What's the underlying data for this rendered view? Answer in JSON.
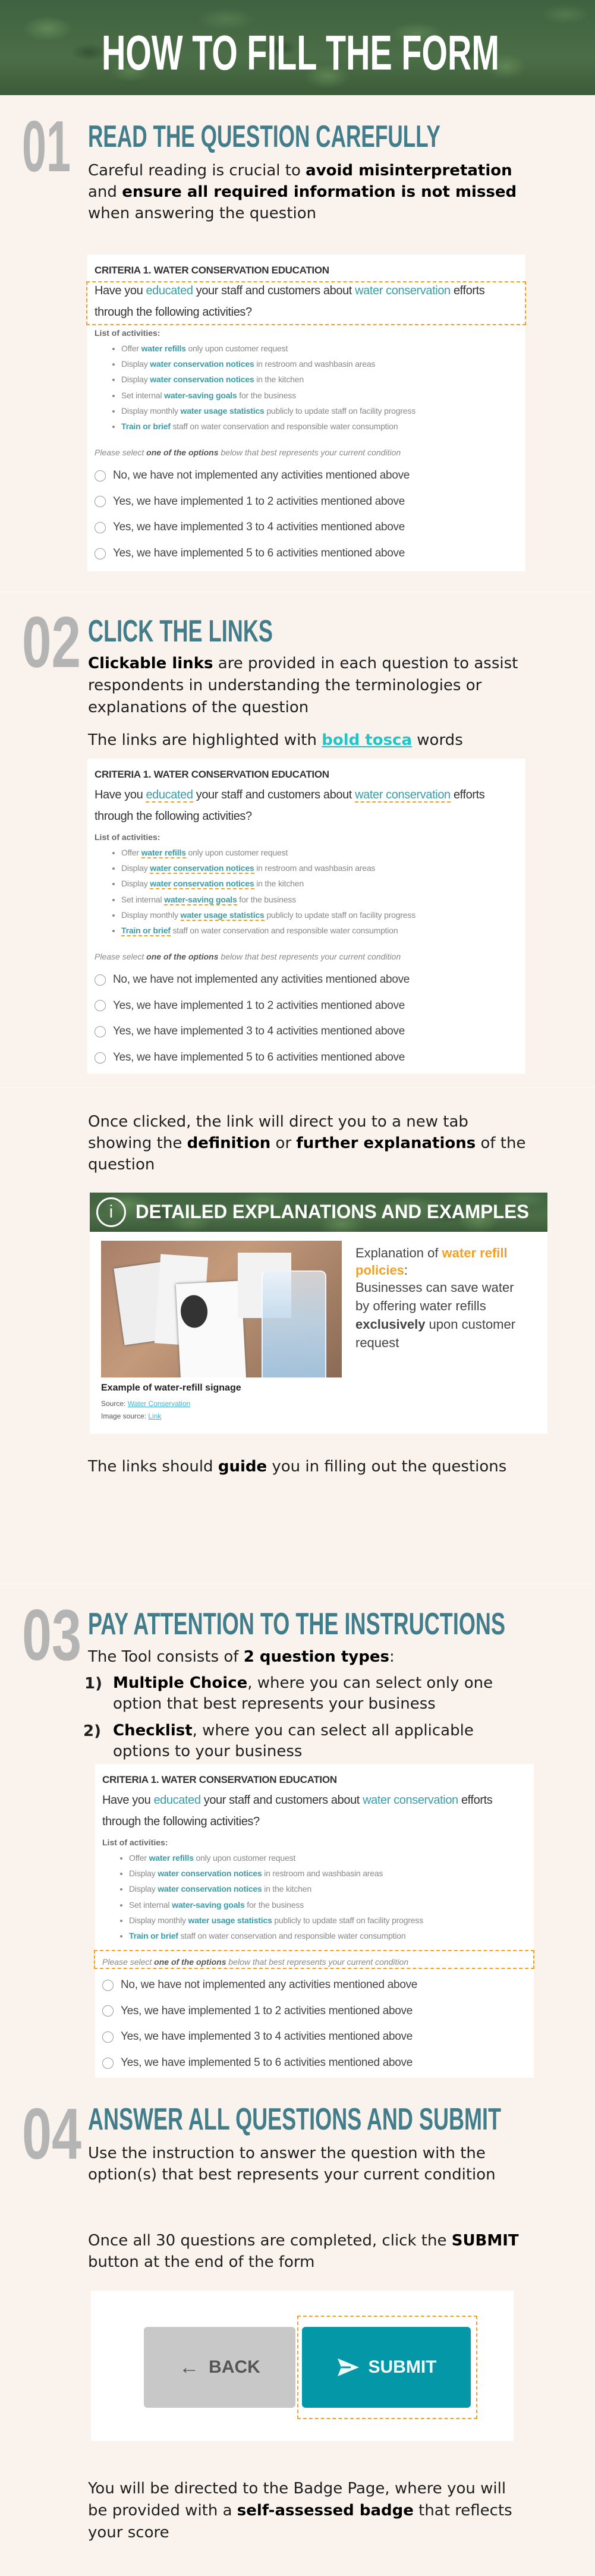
{
  "header": {
    "title": "HOW TO FILL THE FORM"
  },
  "sections": [
    {
      "number": "01",
      "heading": "READ THE QUESTION CAREFULLY",
      "paragraph": [
        {
          "t": "Careful reading is crucial to "
        },
        {
          "t": "avoid misinterpretation",
          "b": true
        },
        {
          "t": " and "
        },
        {
          "t": "ensure all required information is not missed",
          "b": true
        },
        {
          "t": " when answering the question"
        }
      ]
    },
    {
      "number": "02",
      "heading": "CLICK THE LINKS",
      "paragraph": [
        {
          "t": "Clickable links",
          "b": true
        },
        {
          "t": " are provided in each question to assist respondents in understanding the terminologies or explanations of the question"
        }
      ],
      "highlight_note": [
        {
          "t": "The links are highlighted with "
        },
        {
          "t": "bold tosca",
          "tosca": true
        },
        {
          "t": " words"
        }
      ],
      "after_click": [
        {
          "t": "Once clicked, the link will direct you to a new tab showing the "
        },
        {
          "t": "definition",
          "b": true
        },
        {
          "t": " or "
        },
        {
          "t": "further explanations",
          "b": true
        },
        {
          "t": " of the question"
        }
      ],
      "guide_note": [
        {
          "t": "The links should "
        },
        {
          "t": "guide",
          "b": true
        },
        {
          "t": " you in filling out the questions"
        }
      ]
    },
    {
      "number": "03",
      "heading": "PAY ATTENTION TO THE INSTRUCTIONS",
      "paragraph": [
        {
          "t": "The Tool consists of "
        },
        {
          "t": "2 question types",
          "b": true
        },
        {
          "t": ":"
        }
      ],
      "types": [
        {
          "marker": "1)",
          "segments": [
            {
              "t": "Multiple Choice",
              "b": true
            },
            {
              "t": ", where you can select only one option that best represents your business"
            }
          ]
        },
        {
          "marker": "2)",
          "segments": [
            {
              "t": "Checklist",
              "b": true
            },
            {
              "t": ", where you can select all applicable options to your business"
            }
          ]
        }
      ]
    },
    {
      "number": "04",
      "heading": "ANSWER ALL QUESTIONS AND SUBMIT",
      "paragraph": [
        {
          "t": "Use the instruction to answer the question with the option(s) that best represents your current condition"
        }
      ],
      "submit_note": [
        {
          "t": "Once all 30 questions are completed, click the "
        },
        {
          "t": "SUBMIT",
          "b": true
        },
        {
          "t": " button at the end of the form"
        }
      ],
      "badge_note": [
        {
          "t": "You will be directed to the Badge Page, where you will be provided with a "
        },
        {
          "t": "self-assessed badge",
          "b": true
        },
        {
          "t": " that reflects your score"
        }
      ]
    }
  ],
  "form": {
    "criteria": "CRITERIA 1. WATER CONSERVATION EDUCATION",
    "question": [
      {
        "t": "Have you "
      },
      {
        "t": "educated",
        "link": true
      },
      {
        "t": " your staff and customers about "
      },
      {
        "t": "water conservation",
        "link": true
      },
      {
        "t": " efforts through the following activities?"
      }
    ],
    "list_label": "List of activities:",
    "activities": [
      [
        {
          "t": "Offer "
        },
        {
          "t": "water refills",
          "link": true
        },
        {
          "t": " only upon customer request"
        }
      ],
      [
        {
          "t": "Display "
        },
        {
          "t": "water conservation notices",
          "link": true
        },
        {
          "t": " in restroom and washbasin areas"
        }
      ],
      [
        {
          "t": "Display "
        },
        {
          "t": "water conservation notices",
          "link": true
        },
        {
          "t": " in the kitchen"
        }
      ],
      [
        {
          "t": "Set internal "
        },
        {
          "t": "water-saving goals",
          "link": true
        },
        {
          "t": " for the business"
        }
      ],
      [
        {
          "t": "Display monthly "
        },
        {
          "t": "water usage statistics",
          "link": true
        },
        {
          "t": " publicly to update staff on facility progress"
        }
      ],
      [
        {
          "t": "Train or brief",
          "link": true
        },
        {
          "t": " staff on water conservation and responsible water consumption"
        }
      ]
    ],
    "instruction": [
      {
        "t": "Please select "
      },
      {
        "t": "one of the options",
        "b": true
      },
      {
        "t": " below that best represents your current condition"
      }
    ],
    "options": [
      "No, we have not implemented any activities mentioned above",
      "Yes, we have implemented 1 to 2 activities mentioned above",
      "Yes, we have implemented 3 to 4 activities mentioned above",
      "Yes, we have implemented 5 to 6 activities mentioned above"
    ]
  },
  "explanation": {
    "title": "DETAILED EXPLANATIONS AND EXAMPLES",
    "icon": "info-icon",
    "intro": [
      {
        "t": "Explanation of "
      },
      {
        "t": "water refill policies",
        "orange": true
      },
      {
        "t": ":"
      }
    ],
    "body": [
      {
        "t": "Businesses can save water by offering water refills "
      },
      {
        "t": "exclusively",
        "b": true
      },
      {
        "t": " upon customer request"
      }
    ],
    "image_caption": "Example of water-refill signage",
    "source_label": "Source: ",
    "source_link": "Water Conservation",
    "image_source_label": "Image source: ",
    "image_source_link": "Link"
  },
  "submit_panel": {
    "back_label": "BACK",
    "submit_label": "SUBMIT",
    "back_icon": "arrow-left-icon",
    "submit_icon": "send-icon"
  },
  "colors": {
    "background": "#faf3ed",
    "heading": "#417d8a",
    "number": "#b4b4b4",
    "link": "#3a9ca6",
    "tosca": "#1ec6c9",
    "highlight": "#f5a020",
    "submit": "#0397a7",
    "back": "#c8c8c8"
  }
}
